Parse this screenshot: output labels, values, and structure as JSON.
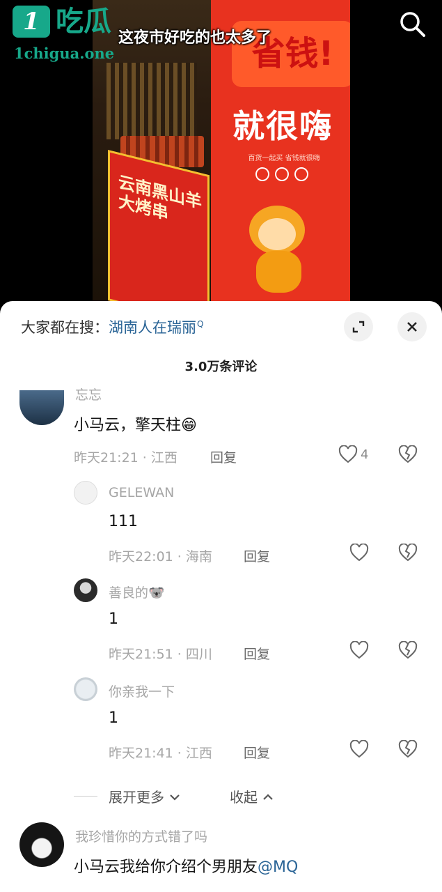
{
  "watermark": {
    "badge": "1",
    "name": "吃瓜",
    "url": "1chigua.one"
  },
  "video": {
    "caption": "这夜市好吃的也太多了",
    "stall_sign": "云南黑山羊大烤串",
    "banner_top": "省钱!",
    "banner_main": "就很嗨",
    "banner_sub": "百货一起买 省钱就很嗨"
  },
  "sheet": {
    "search_prefix": "大家都在搜：",
    "search_term": "湖南人在瑞丽",
    "comment_count": "3.0万条评论",
    "comments": [
      {
        "user": "忘忘",
        "text": "小马云，擎天柱😁",
        "time": "昨天21:21 · 江西",
        "reply": "回复",
        "likes": "4"
      },
      {
        "user": "GELEWAN",
        "text": "111",
        "time": "昨天22:01 · 海南",
        "reply": "回复",
        "likes": ""
      },
      {
        "user": "善良的🐨",
        "text": "1",
        "time": "昨天21:51 · 四川",
        "reply": "回复",
        "likes": ""
      },
      {
        "user": "你亲我一下",
        "text": "1",
        "time": "昨天21:41 · 江西",
        "reply": "回复",
        "likes": ""
      },
      {
        "user": "我珍惜你的方式错了吗",
        "text": "小马云我给你介绍个男朋友",
        "mention": "@MQ"
      }
    ],
    "expand_more": "展开更多",
    "collapse": "收起"
  },
  "colors": {
    "accent_link": "#2a6496",
    "watermark": "#17a88a",
    "banner_red": "#e8321f"
  },
  "icons": [
    "search-icon",
    "expand-icon",
    "close-icon",
    "heart-icon",
    "broken-heart-icon",
    "chevron-down-icon",
    "chevron-up-icon"
  ]
}
